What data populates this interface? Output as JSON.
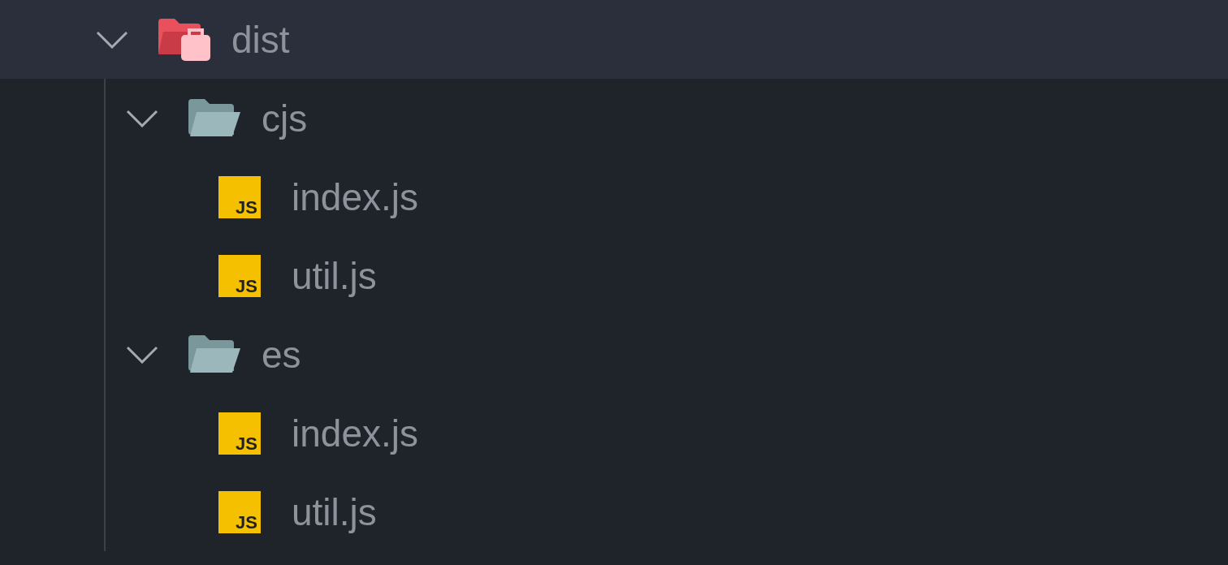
{
  "tree": [
    {
      "kind": "dist_folder",
      "label": "dist",
      "expanded": true,
      "selected": true,
      "children": [
        {
          "kind": "folder",
          "label": "cjs",
          "expanded": true,
          "selected": false,
          "children": [
            {
              "kind": "js_file",
              "label": "index.js",
              "badge": "JS",
              "selected": false
            },
            {
              "kind": "js_file",
              "label": "util.js",
              "badge": "JS",
              "selected": false
            }
          ]
        },
        {
          "kind": "folder",
          "label": "es",
          "expanded": true,
          "selected": false,
          "children": [
            {
              "kind": "js_file",
              "label": "index.js",
              "badge": "JS",
              "selected": false
            },
            {
              "kind": "js_file",
              "label": "util.js",
              "badge": "JS",
              "selected": false
            }
          ]
        }
      ]
    }
  ]
}
